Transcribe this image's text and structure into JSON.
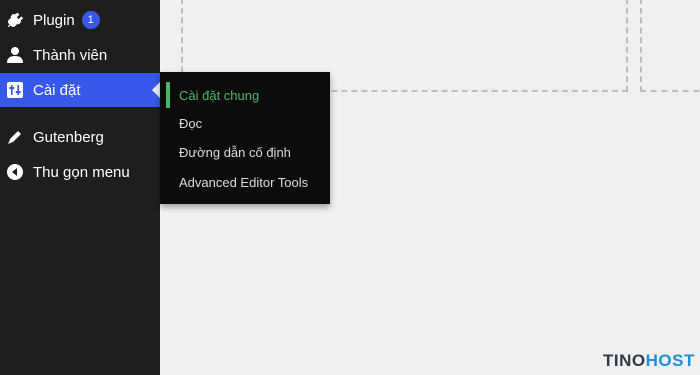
{
  "sidebar": {
    "items": [
      {
        "label": "Plugin",
        "icon": "plug-icon",
        "badge": "1"
      },
      {
        "label": "Thành viên",
        "icon": "user-icon"
      },
      {
        "label": "Cài đặt",
        "icon": "settings-sliders-icon",
        "active": true
      },
      {
        "label": "Gutenberg",
        "icon": "pencil-icon"
      },
      {
        "label": "Thu gọn menu",
        "icon": "collapse-arrow-icon"
      }
    ]
  },
  "flyout": {
    "items": [
      {
        "label": "Cài đặt chung",
        "current": true
      },
      {
        "label": "Đọc"
      },
      {
        "label": "Đường dẫn cố định"
      },
      {
        "label": "Advanced Editor Tools"
      }
    ]
  },
  "watermark": {
    "part1": "TINO",
    "part2": "HOST"
  },
  "colors": {
    "sidebar_bg": "#1e1e1e",
    "active_bg": "#3858e9",
    "flyout_bg": "#0c0c0c",
    "current_accent": "#4ab866",
    "canvas_bg": "#f0f0f0"
  }
}
